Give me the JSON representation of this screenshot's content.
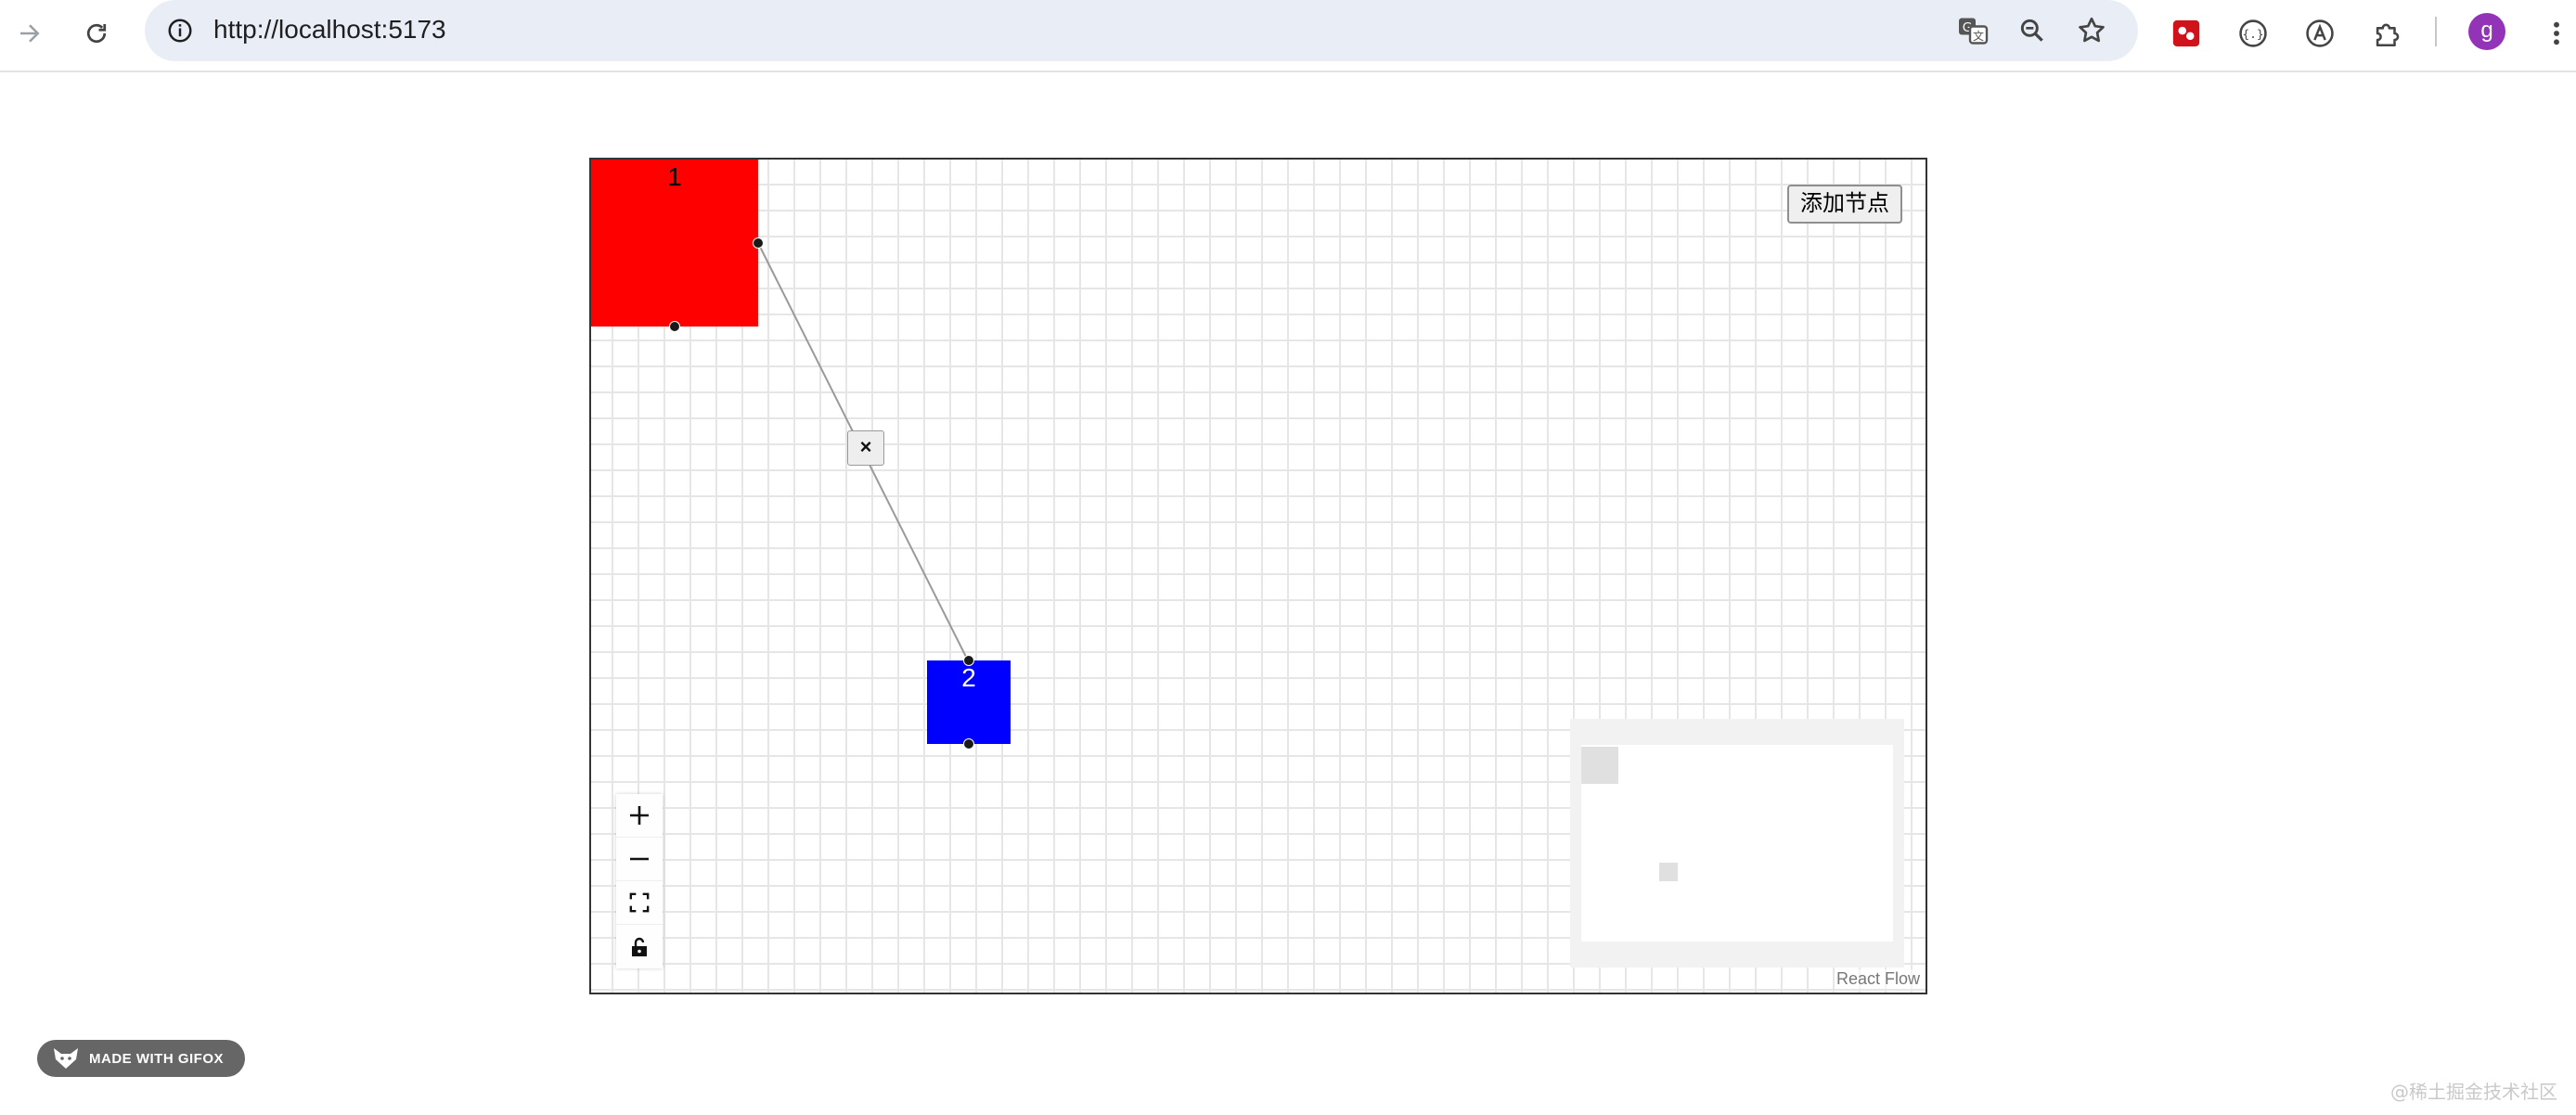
{
  "browser": {
    "url": "http://localhost:5173",
    "avatar_letter": "g",
    "toolbar_icons": [
      "forward-arrow-icon",
      "reload-icon",
      "site-info-icon",
      "translate-icon",
      "zoom-icon",
      "bookmark-star-icon",
      "extension-red-icon",
      "extension-braces-icon",
      "extension-a-icon",
      "extensions-puzzle-icon",
      "menu-kebab-icon"
    ]
  },
  "flow": {
    "add_node_label": "添加节点",
    "edge_delete_label": "×",
    "nodes": [
      {
        "id": "1",
        "label": "1",
        "color": "#ff0000"
      },
      {
        "id": "2",
        "label": "2",
        "color": "#0000ff"
      }
    ],
    "edges": [
      {
        "source": "1",
        "target": "2"
      }
    ],
    "controls": [
      "zoom-in",
      "zoom-out",
      "fit-view",
      "toggle-interactivity"
    ],
    "attribution": "React Flow"
  },
  "overlay": {
    "gifox_label": "MADE WITH GIFOX",
    "watermark": "@稀土掘金技术社区"
  }
}
